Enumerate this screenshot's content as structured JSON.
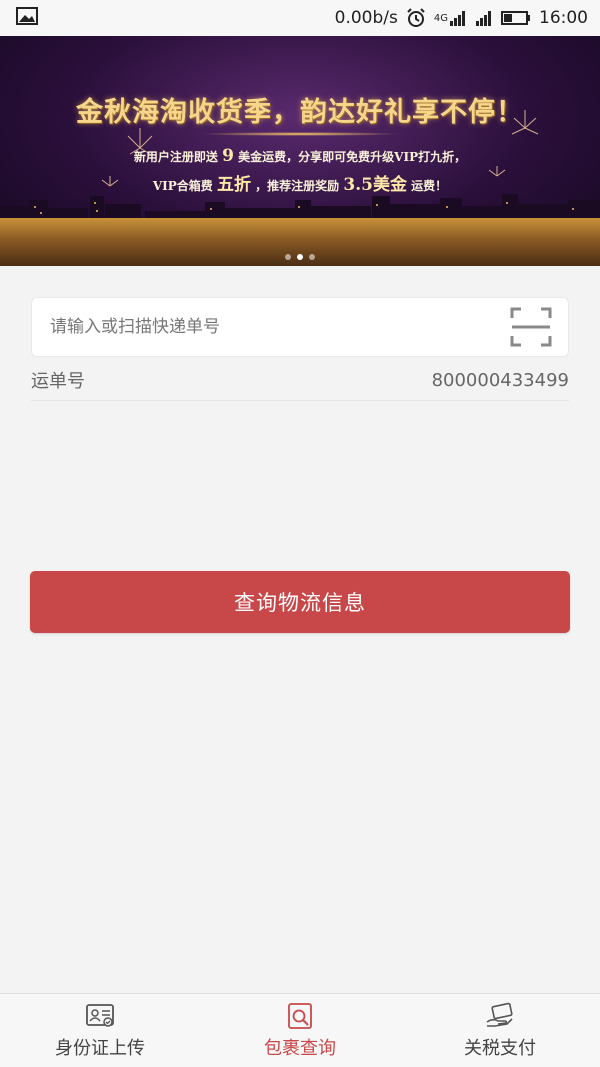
{
  "status_bar": {
    "net_speed": "0.00b/s",
    "network_type": "4G",
    "time": "16:00",
    "icons": [
      "image-icon",
      "alarm-icon",
      "signal-icon",
      "signal-icon",
      "battery-icon"
    ]
  },
  "banner": {
    "title": "金秋海淘收货季，韵达好礼享不停！",
    "line1_pre": "新用户注册即送",
    "line1_big": "9",
    "line1_post": "美金运费，分享即可免费升级VIP打九折，",
    "line2_pre": "VIP合箱费",
    "line2_big": "五折",
    "line2_mid": "，推荐注册奖励",
    "line2_big2": "3.5美金",
    "line2_post": "运费！",
    "page_count": 3,
    "active_page": 2
  },
  "search": {
    "placeholder": "请输入或扫描快递单号",
    "value": "",
    "scan_icon": "scan-icon"
  },
  "waybill": {
    "label": "运单号",
    "value": "800000433499"
  },
  "query_button": {
    "label": "查询物流信息"
  },
  "colors": {
    "accent": "#c8484a",
    "background": "#f3f3f3"
  },
  "bottom_nav": {
    "items": [
      {
        "label": "身份证上传",
        "icon": "id-card-icon",
        "active": false
      },
      {
        "label": "包裹查询",
        "icon": "package-search-icon",
        "active": true
      },
      {
        "label": "关税支付",
        "icon": "payment-icon",
        "active": false
      }
    ]
  }
}
